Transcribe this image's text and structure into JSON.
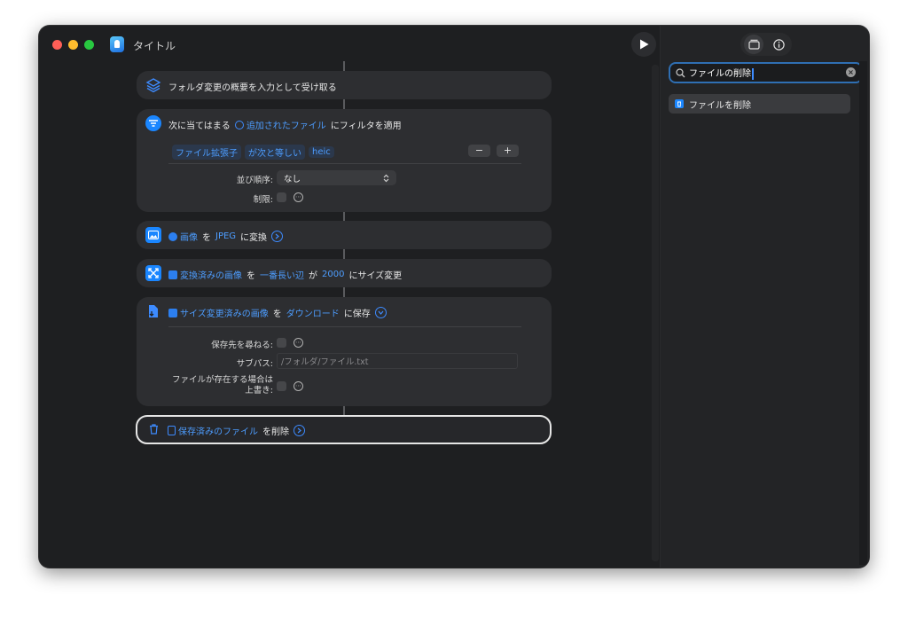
{
  "window": {
    "title": "タイトル"
  },
  "toolbar": {
    "play_icon": "play-icon"
  },
  "sidebar": {
    "tabs": [
      {
        "icon": "library-icon",
        "active": true
      },
      {
        "icon": "info-icon",
        "active": false
      }
    ],
    "search": {
      "value": "ファイルの削除",
      "clear_icon": "clear-icon"
    },
    "results": [
      {
        "label": "ファイルを削除",
        "icon": "trash-icon"
      }
    ]
  },
  "actions": {
    "a1": {
      "label": "フォルダ変更の概要を入力として受け取る"
    },
    "a2": {
      "prefix": "次に当てはまる",
      "token": "追加されたファイル",
      "suffix": "にフィルタを適用",
      "condition": {
        "field": "ファイル拡張子",
        "op": "が次と等しい",
        "value": "heic"
      },
      "minus": "−",
      "plus": "+",
      "sort_label": "並び順序:",
      "sort_value": "なし",
      "limit_label": "制限:"
    },
    "a3": {
      "token1": "画像",
      "mid": "を",
      "token2": "JPEG",
      "suffix": "に変換"
    },
    "a4": {
      "token1": "変換済みの画像",
      "mid1": "を",
      "token2": "一番長い辺",
      "mid2": "が",
      "token3": "2000",
      "suffix": "にサイズ変更"
    },
    "a5": {
      "token1": "サイズ変更済みの画像",
      "mid": "を",
      "token2": "ダウンロード",
      "suffix": "に保存",
      "ask_label": "保存先を尋ねる:",
      "subpath_label": "サブパス:",
      "subpath_value": "/フォルダ/ファイル.txt",
      "overwrite_label_1": "ファイルが存在する場合は",
      "overwrite_label_2": "上書き:"
    },
    "a6": {
      "token": "保存済みのファイル",
      "suffix": "を削除"
    }
  },
  "colors": {
    "accent": "#1a86ff",
    "window_bg": "#1e1f21",
    "card_bg": "#2d2e31",
    "search_border": "#2f6fb3"
  }
}
